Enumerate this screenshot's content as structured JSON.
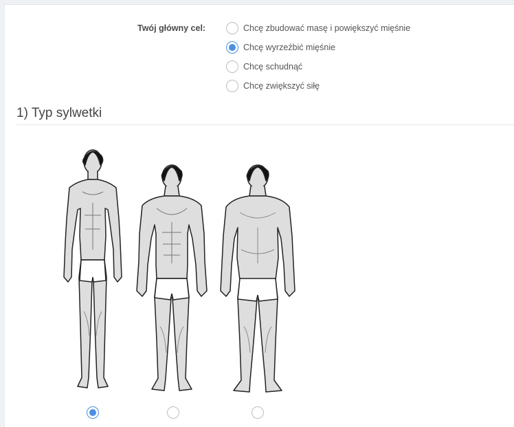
{
  "goal": {
    "label": "Twój główny cel:",
    "options": [
      {
        "label": "Chcę zbudować masę i powiększyć mięśnie",
        "selected": false
      },
      {
        "label": "Chcę wyrzeźbić mięśnie",
        "selected": true
      },
      {
        "label": "Chcę schudnąć",
        "selected": false
      },
      {
        "label": "Chcę zwiększyć siłę",
        "selected": false
      }
    ]
  },
  "section": {
    "title": "1) Typ sylwetki"
  },
  "body_types": {
    "options": [
      {
        "icon": "slim-body-figure-icon",
        "selected": true
      },
      {
        "icon": "athletic-body-figure-icon",
        "selected": false
      },
      {
        "icon": "heavy-body-figure-icon",
        "selected": false
      }
    ]
  },
  "colors": {
    "accent": "#4a90e2",
    "radio_border": "#b9bec4",
    "text": "#444444",
    "background": "#eef1f4"
  }
}
